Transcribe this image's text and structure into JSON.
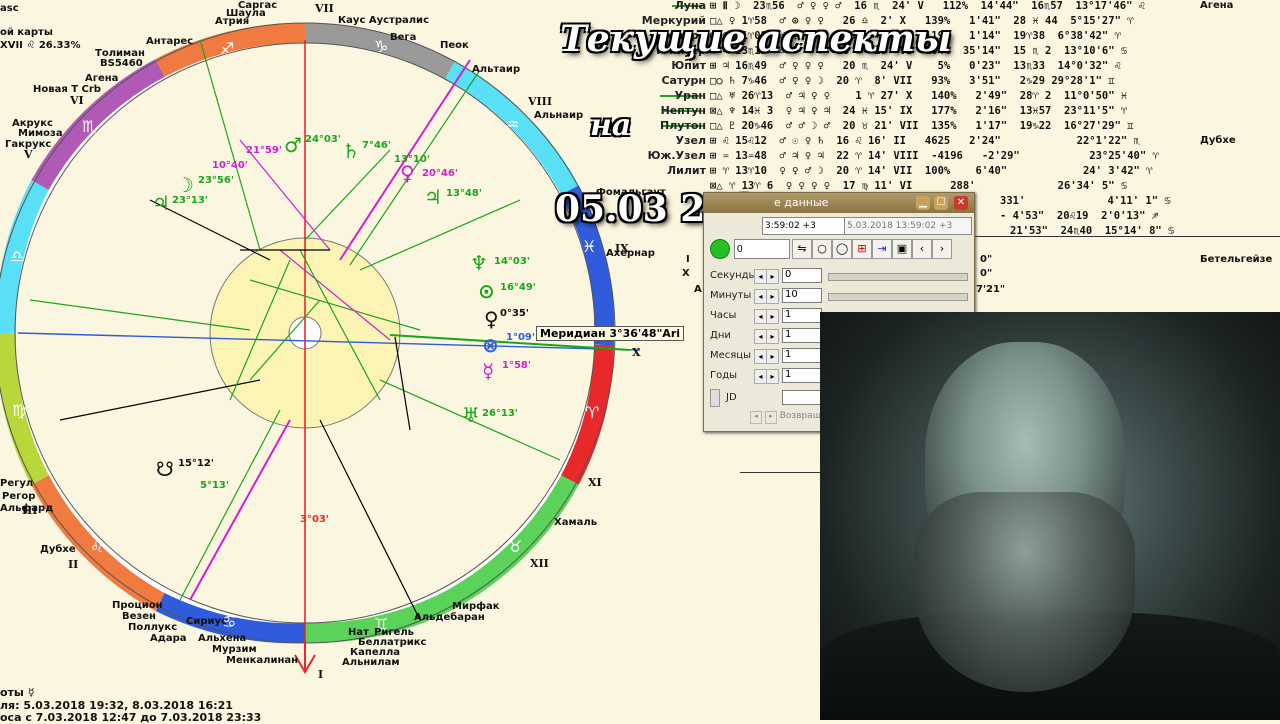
{
  "header_left": {
    "lines": [
      "asc",
      "ой карты",
      "XVII ♌ 26.33%"
    ]
  },
  "chart_labels": {
    "top_stars": [
      "Саргас",
      "Шаула",
      "Атрия",
      "Антарес",
      "Толиман",
      "BS5460",
      "Агена",
      "Новая Т Crb",
      "Акрукс",
      "Мимоза",
      "Гакрукс",
      "Каус Аустралис",
      "Вега",
      "Альтаир",
      "Альнаир",
      "Пеок"
    ],
    "left_stars": [
      "Регул",
      "Регор",
      "Альфард",
      "Дубхе",
      "Процион",
      "Везен",
      "Поллукс",
      "Адара",
      "Сириус",
      "Альхена",
      "Мурзим",
      "Менкалинан"
    ],
    "bottom_stars": [
      "Нат",
      "Ригель",
      "Беллатрикс",
      "Капелла",
      "Альнилам",
      "Альдебаран",
      "Мирфак",
      "Хамаль"
    ],
    "right_stars": [
      "Фомальгаут",
      "Ахернар"
    ],
    "houses": [
      "VII",
      "VIII",
      "IX",
      "X",
      "XI",
      "XII",
      "I",
      "II",
      "III",
      "V",
      "VI"
    ],
    "planet_degrees": [
      "24°03'",
      "7°46'",
      "13°10'",
      "20°46'",
      "13°48'",
      "21°59'",
      "10°40'",
      "23°56'",
      "23°13'",
      "14°03'",
      "16°49'",
      "0°35'",
      "1°09'",
      "1°58'",
      "26°13'",
      "15°12'",
      "5°13'",
      "3°03'"
    ],
    "meridian_tooltip": "Меридиан  3°36'48\"Ari",
    "side_marks": [
      "X",
      "D",
      "Eq",
      "XI"
    ]
  },
  "title_overlay": {
    "line1": "Текущие аспекты",
    "line2": "на",
    "line3": "05.03  2018 года"
  },
  "planets": [
    {
      "name": "Луна",
      "row": "⊞ Ⅱ ☽  23♏56  ♂ ♀ ♀ ♂  16 ♏  24' V   112%  14'44\"  16♏57  13°17'46\" ♌"
    },
    {
      "name": "Меркурий",
      "row": "□△ ♀ 1♈58  ♂ ⊙ ♀ ♀   26 ♎  2' X   139%   1'41\"  28 ♓ 44  5°15'27\" ♈"
    },
    {
      "name": "Венера",
      "row": "⊞ ♀  1♈09  ♂ ♀ ♀ ♀   26 ♎  1' X   119%   1'14\"  19♈38  6°38'42\" ♈"
    },
    {
      "name": "Юпитер",
      "row": "⊞ ♃ 23♏13  ♂ ⊙ ♃ ☽  18 ♋  25' VI  104%  35'14\"  15 ♏ 2  13°10'6\" ♋"
    },
    {
      "name": "Юпит",
      "row": "⊞ ♃ 16♏49  ♂ ♀ ♀ ♀   20 ♏  24' V    5%   0'23\"  13♏33  14°0'32\" ♌"
    },
    {
      "name": "Сатурн",
      "row": "□○ ♄ 7♑46  ♂ ♀ ♀ ☽  20 ♈  8' VII   93%   3'51\"   2♑29 29°28'1\" ♊"
    },
    {
      "name": "Уран",
      "row": "□△ ♅ 26♈13  ♂ ♃ ♀ ♀    1 ♈ 27' X   140%   2'49\"  28♈ 2  11°0'50\" ♓"
    },
    {
      "name": "Нептун",
      "row": "⊠△ ♆ 14♓ 3  ♀ ♃ ♀ ♃  24 ♓ 15' IX   177%   2'16\"  13♓57  23°11'5\" ♈"
    },
    {
      "name": "Плутон",
      "row": "□△ ♇ 20♑46  ♂ ♂ ☽ ♂  20 ♉ 21' VII  135%   1'17\"  19♑22  16°27'29\" ♊"
    },
    {
      "name": "Узел",
      "row": "⊞ ♌ 15♌12  ♂ ☉ ♀ ♄  16 ♌ 16' II   4625   2'24\"            22°1'22\" ♏"
    },
    {
      "name": "Юж.Узел",
      "row": "⊞ ♒ 13♒48  ♂ ♃ ♀ ♃  22 ♈ 14' VIII  -4196   -2'29\"           23°25'40\" ♈"
    },
    {
      "name": "Лилит",
      "row": "⊞ ♈ 13♈10  ♀ ♀ ♂ ☽  20 ♈ 14' VII  100%    6'40\"            24' 3'42\" ♈"
    },
    {
      "name": "",
      "row": "⊠△ ♈ 13♈ 6  ♀ ♀ ♀ ♀  17 ♍ 11' VI      288'             26'34' 5\" ♋"
    }
  ],
  "planet_extra": [
    "Агена",
    "Дубхе",
    "Бетельгейзе"
  ],
  "trailing_rows": [
    "331'             4'11' 1\" ♋",
    "- 4'53\"  20♌19  2'0'13\" ♐",
    "21'53\"  24♏40  15°14' 8\" ♋"
  ],
  "misc_right": [
    "I",
    "X",
    "A",
    "0\"",
    "0\"",
    "7'21\""
  ],
  "dialog": {
    "title": "е данные",
    "time_field": "3:59:02 +3",
    "time_field2": "5.03.2018  13:59:02 +3",
    "input_value": "0",
    "fields": [
      {
        "label": "Секунды",
        "value": "0"
      },
      {
        "label": "Минуты",
        "value": "10"
      },
      {
        "label": "Часы",
        "value": "1"
      },
      {
        "label": "Дни",
        "value": "1"
      },
      {
        "label": "Месяцы",
        "value": "1"
      },
      {
        "label": "Годы",
        "value": "1"
      },
      {
        "label": "JD",
        "value": ""
      }
    ],
    "return_label": "Возвращ"
  },
  "bottom_text": [
    "оты  ☿",
    "ля: 5.03.2018 19:32,  8.03.2018 16:21",
    "оса с 7.03.2018 12:47 до 7.03.2018 23:33"
  ],
  "colors": {
    "background": "#fbf6df",
    "inner_disc": "#fbf4b4",
    "ring_red": "#e8282a",
    "ring_blue": "#2f5bdc",
    "ring_green": "#5bd35b",
    "ring_cyan": "#59dff6",
    "ring_purple": "#b05ab8",
    "ring_orange": "#f07a40",
    "ring_grey": "#9a9a9a",
    "ring_yellowgreen": "#b9d73a",
    "planet_green": "#1aa61a",
    "planet_magenta": "#d020d0"
  }
}
